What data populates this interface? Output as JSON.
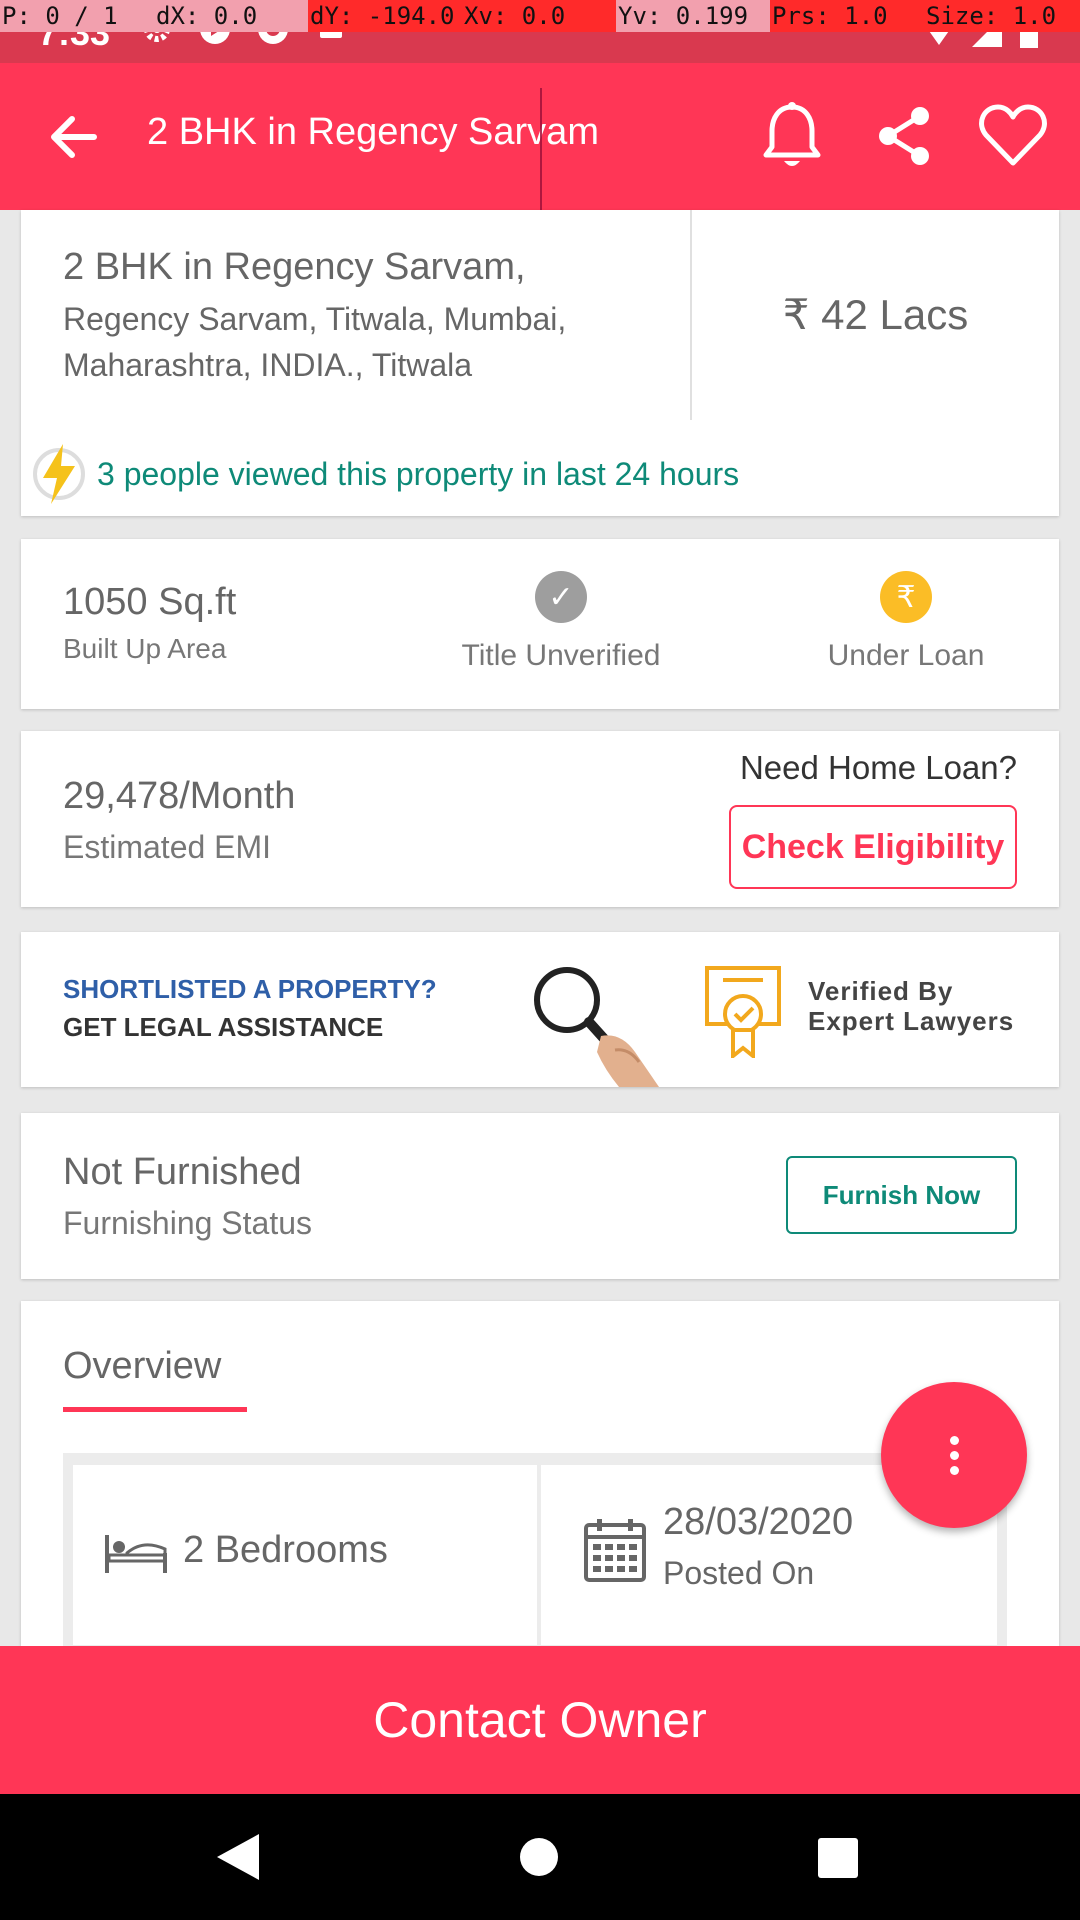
{
  "status_bar": {
    "time": "7:33",
    "debug": [
      "P: 0 / 1",
      "dX: 0.0",
      "dY: -194.0",
      "Xv: 0.0",
      "Yv: 0.199",
      "Prs: 1.0",
      "Size: 1.0"
    ]
  },
  "app_bar": {
    "title": "2 BHK in Regency Sarvam"
  },
  "property": {
    "title": "2 BHK in Regency Sarvam,",
    "address": "Regency Sarvam, Titwala, Mumbai, Maharashtra, INDIA., Titwala",
    "price": "₹ 42 Lacs",
    "views_text": "3 people viewed this property in last 24 hours"
  },
  "area": {
    "value": "1050 Sq.ft",
    "label": "Built Up Area",
    "title_status": "Title Unverified",
    "title_icon": "✓",
    "loan_status": "Under Loan",
    "loan_icon": "₹"
  },
  "emi": {
    "value": "29,478/Month",
    "label": "Estimated EMI",
    "prompt": "Need Home Loan?",
    "button": "Check Eligibility"
  },
  "legal": {
    "line1": "SHORTLISTED A PROPERTY?",
    "line2": "GET LEGAL ASSISTANCE",
    "verified_line1": "Verified By",
    "verified_line2": "Expert Lawyers"
  },
  "furnishing": {
    "value": "Not Furnished",
    "label": "Furnishing Status",
    "button": "Furnish Now"
  },
  "overview": {
    "tab": "Overview",
    "bedrooms": "2 Bedrooms",
    "posted_date": "28/03/2020",
    "posted_label": "Posted On"
  },
  "contact": {
    "button": "Contact Owner"
  },
  "colors": {
    "accent": "#ff3656",
    "teal": "#0e8a78",
    "legal_blue": "#2f5fa8"
  }
}
